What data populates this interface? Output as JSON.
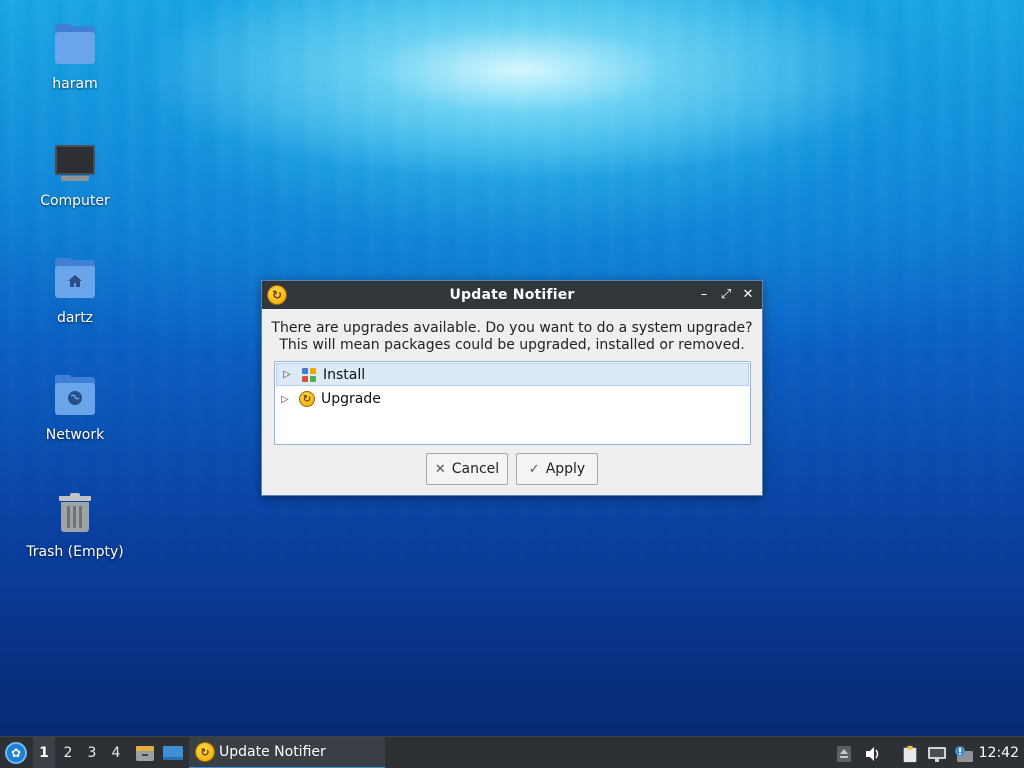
{
  "desktop": {
    "icons": [
      {
        "label": "haram",
        "icon": "folder-icon"
      },
      {
        "label": "Computer",
        "icon": "computer-icon"
      },
      {
        "label": "dartz",
        "icon": "home-folder-icon"
      },
      {
        "label": "Network",
        "icon": "network-folder-icon"
      },
      {
        "label": "Trash (Empty)",
        "icon": "trash-icon"
      }
    ]
  },
  "dialog": {
    "title": "Update Notifier",
    "message_line1": "There are upgrades available. Do you want to do a system upgrade?",
    "message_line2": "This will mean packages could be upgraded, installed or removed.",
    "tree_items": [
      {
        "label": "Install",
        "icon": "install-grid-icon",
        "selected": true
      },
      {
        "label": "Upgrade",
        "icon": "upgrade-icon",
        "selected": false
      }
    ],
    "cancel_label": "Cancel",
    "apply_label": "Apply",
    "accent_color": "#31363b"
  },
  "taskbar": {
    "workspaces": [
      "1",
      "2",
      "3",
      "4"
    ],
    "active_workspace": "1",
    "task_label": "Update Notifier",
    "clock": "12:42",
    "accent_color": "#3d8fd6"
  }
}
